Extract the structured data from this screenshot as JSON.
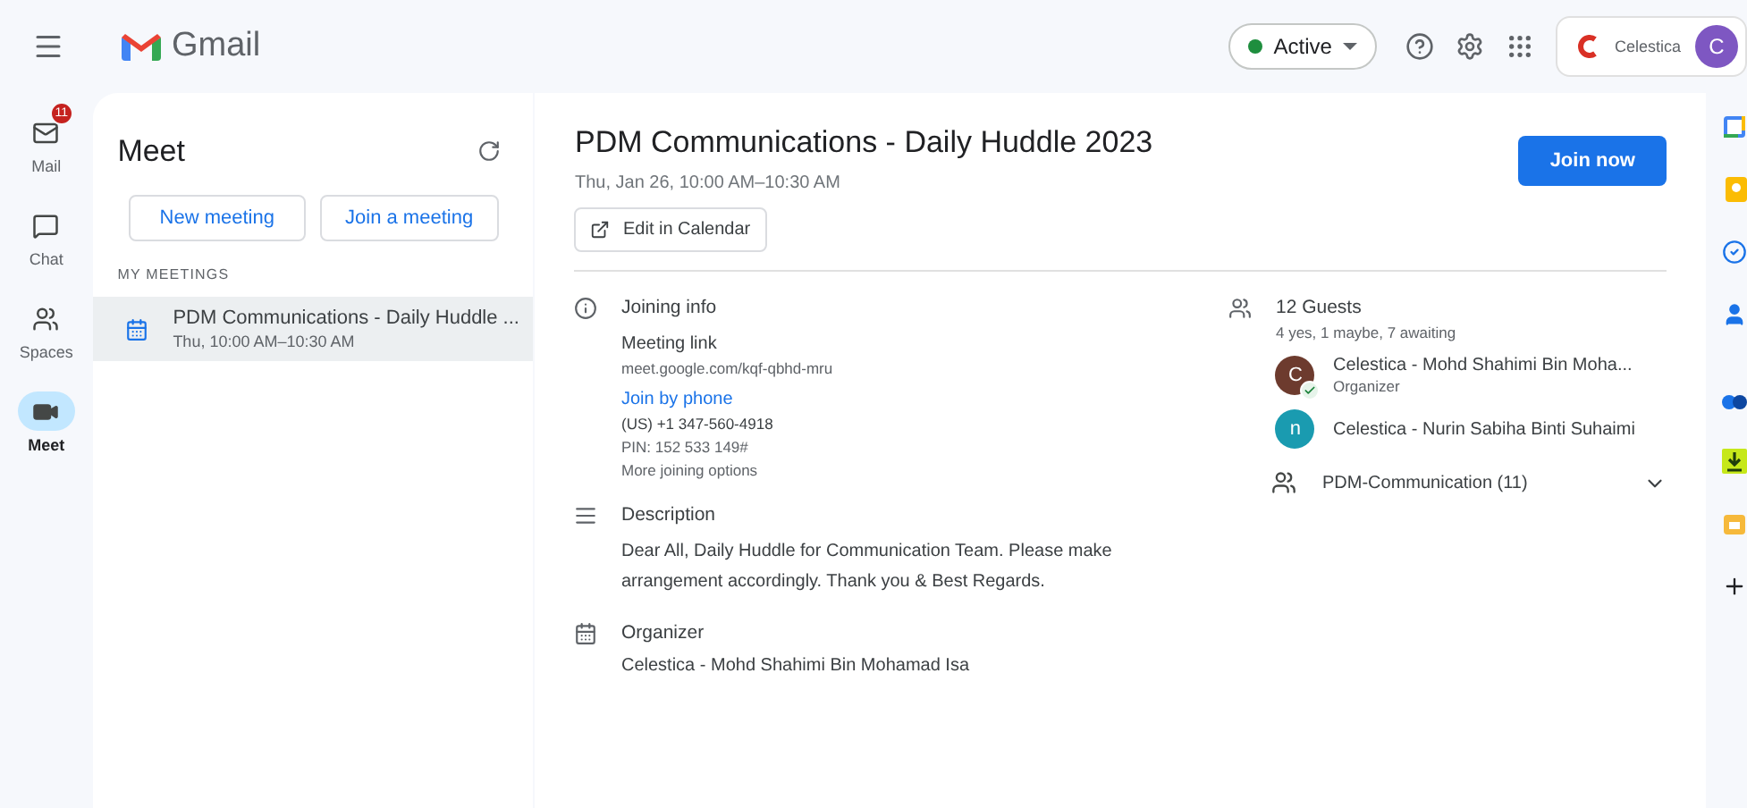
{
  "header": {
    "app_name": "Gmail",
    "status": {
      "label": "Active",
      "color": "#1e8e3e"
    },
    "org": "Celestica",
    "avatar": "C"
  },
  "nav": [
    {
      "kind": "mail",
      "label": "Mail",
      "badge": "11",
      "selected": false
    },
    {
      "kind": "chat",
      "label": "Chat",
      "selected": false
    },
    {
      "kind": "spaces",
      "label": "Spaces",
      "selected": false
    },
    {
      "kind": "meet",
      "label": "Meet",
      "selected": true
    }
  ],
  "meet_panel": {
    "title": "Meet",
    "buttons": [
      "New meeting",
      "Join a meeting"
    ],
    "section": "MY MEETINGS",
    "meetings": [
      {
        "title": "PDM Communications - Daily Huddle ...",
        "time": "Thu, 10:00 AM–10:30 AM",
        "selected": true
      }
    ]
  },
  "event": {
    "title": "PDM Communications - Daily Huddle 2023",
    "when": "Thu, Jan 26, 10:00 AM–10:30 AM",
    "edit_button": "Edit in Calendar",
    "join_button": "Join now",
    "joining": {
      "heading": "Joining info",
      "link_label": "Meeting link",
      "link": "meet.google.com/kqf-qbhd-mru",
      "phone_link": "Join by phone",
      "phone": "(US) +1 347-560-4918",
      "pin": "PIN: 152 533 149#",
      "more": "More joining options"
    },
    "description": {
      "heading": "Description",
      "text": "Dear All, Daily Huddle for Communication Team. Please make arrangement accordingly. Thank you & Best Regards."
    },
    "organizer": {
      "heading": "Organizer",
      "name": "Celestica - Mohd Shahimi Bin Mohamad Isa"
    },
    "guests": {
      "heading": "12 Guests",
      "summary": "4 yes, 1 maybe, 7 awaiting",
      "people": [
        {
          "initial": "C",
          "color": "#6d3b2e",
          "name": "Celestica - Mohd Shahimi Bin Moha...",
          "role": "Organizer",
          "accepted": true
        },
        {
          "initial": "n",
          "color": "#1a9bb0",
          "name": "Celestica - Nurin Sabiha Binti Suhaimi",
          "accepted": false
        }
      ],
      "group": {
        "name": "PDM-Communication (11)",
        "expanded": false
      }
    }
  }
}
